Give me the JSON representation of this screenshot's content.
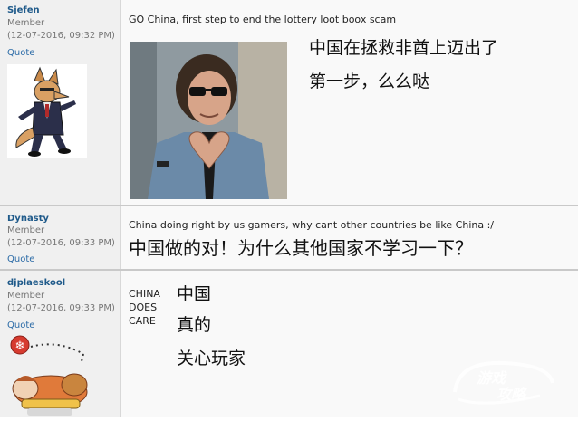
{
  "posts": [
    {
      "username": "Sjefen",
      "role": "Member",
      "date": "(12-07-2016, 09:32 PM)",
      "quote_label": "Quote",
      "avatar_icon": "anime-fox-avatar",
      "text": "GO China, first step to end the lottery loot boox scam",
      "photo_icon": "man-heart-hands-photo",
      "translation_lines": [
        "中国在拯救非酋上迈出了",
        "第一步，么么哒"
      ]
    },
    {
      "username": "Dynasty",
      "role": "Member",
      "date": "(12-07-2016, 09:33 PM)",
      "quote_label": "Quote",
      "text": "China doing right by us gamers, why cant other countries be like China :/",
      "translation": "中国做的对！为什么其他国家不学习一下？"
    },
    {
      "username": "djplaeskool",
      "role": "Member",
      "date": "(12-07-2016, 09:33 PM)",
      "quote_label": "Quote",
      "avatar_icon": "sleeping-character-avatar",
      "text_lines": [
        "CHINA",
        "DOES",
        "CARE"
      ],
      "translation_lines": [
        "中国",
        "真的",
        "关心玩家"
      ]
    }
  ],
  "watermark": {
    "text": "游戏\n攻略",
    "icon": "site-watermark-logo"
  },
  "colors": {
    "username": "#1f5a8a",
    "sidebar_bg": "#f0f0f0",
    "post_bg": "#f9f9f9"
  }
}
